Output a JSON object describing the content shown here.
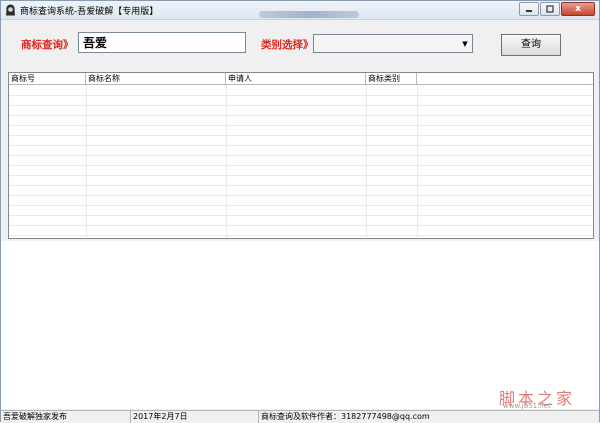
{
  "window": {
    "title": "商标查询系统-吾爱破解【专用版】",
    "buttons": {
      "close": "x"
    }
  },
  "search": {
    "query_label": "商标查询》",
    "query_value": "吾爱",
    "category_label": "类别选择》",
    "category_selected": "",
    "query_button": "查询"
  },
  "table": {
    "columns": [
      "商标号",
      "商标名称",
      "申请人",
      "商标类别"
    ],
    "rows": []
  },
  "statusbar": {
    "publisher": "吾爱破解独家发布",
    "date": "2017年2月7日",
    "author": "商标查询及软件作者：3182777498@qq.com"
  },
  "watermark": {
    "main": "脚本之家",
    "url": "www.jb51.net"
  },
  "colors": {
    "label_red": "#e0261f",
    "title_bar": "#dfe7f2",
    "close_button": "#c9462f"
  },
  "icons": [
    "app-icon",
    "dropdown-arrow-icon",
    "minimize-icon",
    "maximize-icon",
    "close-icon"
  ]
}
